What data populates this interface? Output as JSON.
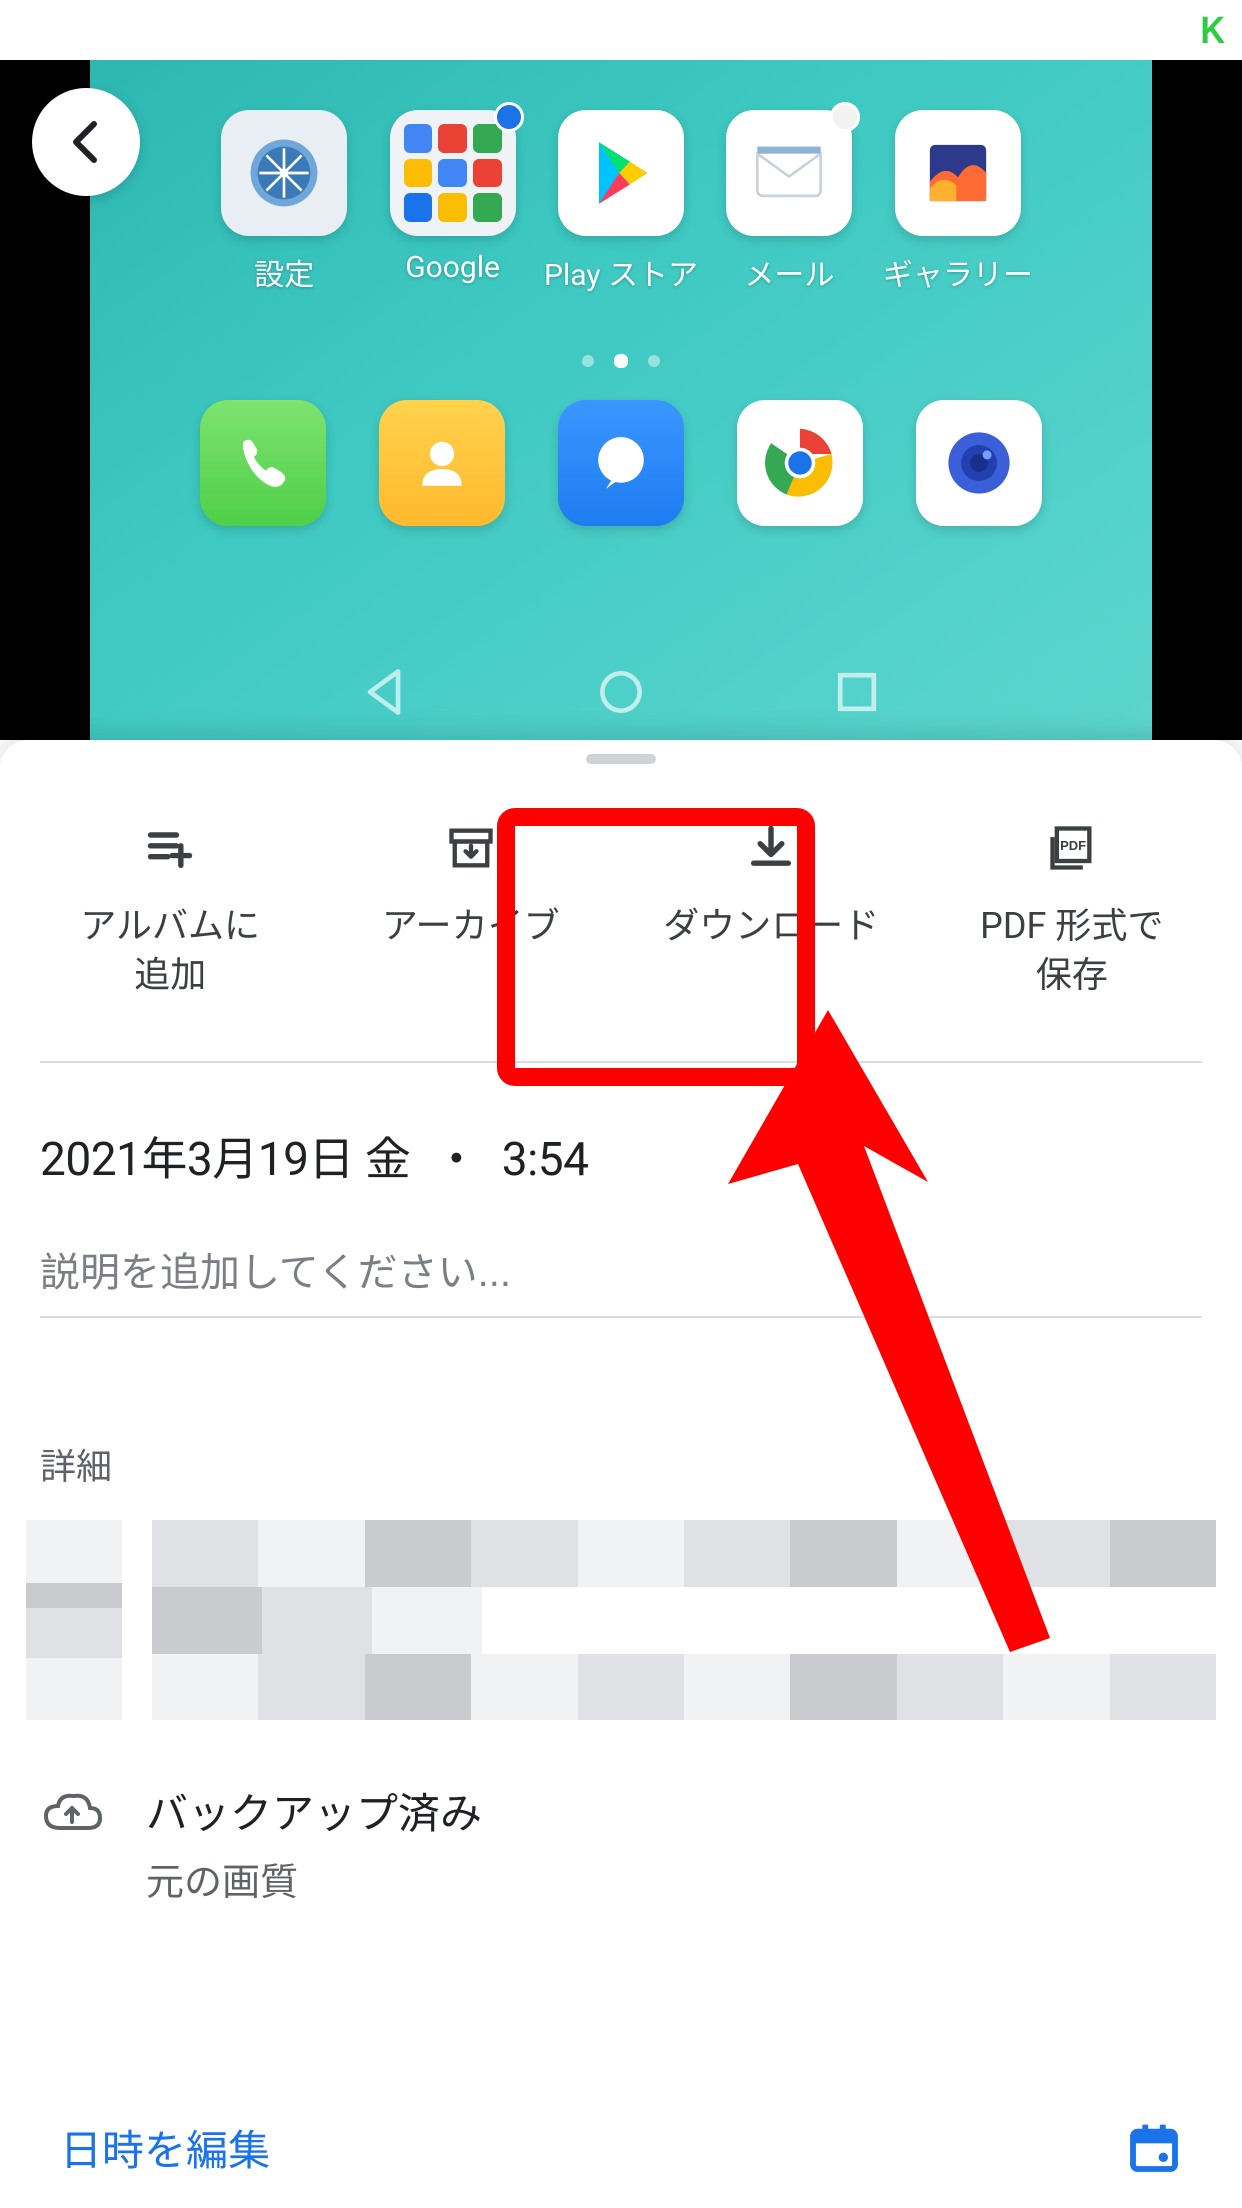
{
  "status": {
    "indicator": "K"
  },
  "photo": {
    "apps": [
      {
        "label": "設定",
        "name": "settings"
      },
      {
        "label": "Google",
        "name": "google"
      },
      {
        "label": "Play ストア",
        "name": "play-store"
      },
      {
        "label": "メール",
        "name": "mail"
      },
      {
        "label": "ギャラリー",
        "name": "gallery"
      }
    ]
  },
  "sheet": {
    "actions": [
      {
        "label": "アルバムに\n追加",
        "name": "add-to-album"
      },
      {
        "label": "アーカイブ",
        "name": "archive"
      },
      {
        "label": "ダウンロード",
        "name": "download"
      },
      {
        "label": "PDF 形式で\n保存",
        "name": "save-as-pdf"
      }
    ],
    "date": "2021年3月19日 金",
    "time": "3:54",
    "description_placeholder": "説明を追加してください...",
    "details_header": "詳細",
    "backup": {
      "title": "バックアップ済み",
      "subtitle": "元の画質"
    },
    "edit_datetime": "日時を編集"
  }
}
